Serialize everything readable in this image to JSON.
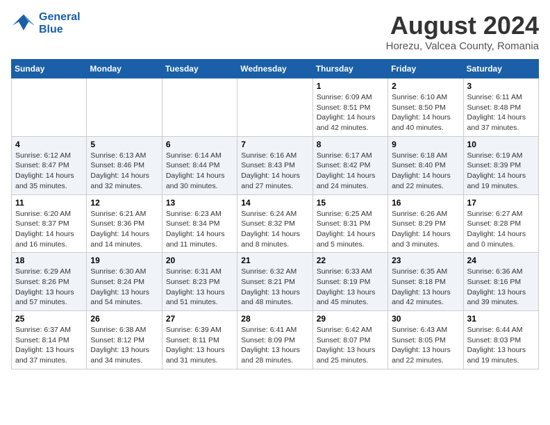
{
  "logo": {
    "line1": "General",
    "line2": "Blue"
  },
  "title": {
    "month_year": "August 2024",
    "location": "Horezu, Valcea County, Romania"
  },
  "days_of_week": [
    "Sunday",
    "Monday",
    "Tuesday",
    "Wednesday",
    "Thursday",
    "Friday",
    "Saturday"
  ],
  "weeks": [
    [
      {
        "num": "",
        "info": ""
      },
      {
        "num": "",
        "info": ""
      },
      {
        "num": "",
        "info": ""
      },
      {
        "num": "",
        "info": ""
      },
      {
        "num": "1",
        "info": "Sunrise: 6:09 AM\nSunset: 8:51 PM\nDaylight: 14 hours\nand 42 minutes."
      },
      {
        "num": "2",
        "info": "Sunrise: 6:10 AM\nSunset: 8:50 PM\nDaylight: 14 hours\nand 40 minutes."
      },
      {
        "num": "3",
        "info": "Sunrise: 6:11 AM\nSunset: 8:48 PM\nDaylight: 14 hours\nand 37 minutes."
      }
    ],
    [
      {
        "num": "4",
        "info": "Sunrise: 6:12 AM\nSunset: 8:47 PM\nDaylight: 14 hours\nand 35 minutes."
      },
      {
        "num": "5",
        "info": "Sunrise: 6:13 AM\nSunset: 8:46 PM\nDaylight: 14 hours\nand 32 minutes."
      },
      {
        "num": "6",
        "info": "Sunrise: 6:14 AM\nSunset: 8:44 PM\nDaylight: 14 hours\nand 30 minutes."
      },
      {
        "num": "7",
        "info": "Sunrise: 6:16 AM\nSunset: 8:43 PM\nDaylight: 14 hours\nand 27 minutes."
      },
      {
        "num": "8",
        "info": "Sunrise: 6:17 AM\nSunset: 8:42 PM\nDaylight: 14 hours\nand 24 minutes."
      },
      {
        "num": "9",
        "info": "Sunrise: 6:18 AM\nSunset: 8:40 PM\nDaylight: 14 hours\nand 22 minutes."
      },
      {
        "num": "10",
        "info": "Sunrise: 6:19 AM\nSunset: 8:39 PM\nDaylight: 14 hours\nand 19 minutes."
      }
    ],
    [
      {
        "num": "11",
        "info": "Sunrise: 6:20 AM\nSunset: 8:37 PM\nDaylight: 14 hours\nand 16 minutes."
      },
      {
        "num": "12",
        "info": "Sunrise: 6:21 AM\nSunset: 8:36 PM\nDaylight: 14 hours\nand 14 minutes."
      },
      {
        "num": "13",
        "info": "Sunrise: 6:23 AM\nSunset: 8:34 PM\nDaylight: 14 hours\nand 11 minutes."
      },
      {
        "num": "14",
        "info": "Sunrise: 6:24 AM\nSunset: 8:32 PM\nDaylight: 14 hours\nand 8 minutes."
      },
      {
        "num": "15",
        "info": "Sunrise: 6:25 AM\nSunset: 8:31 PM\nDaylight: 14 hours\nand 5 minutes."
      },
      {
        "num": "16",
        "info": "Sunrise: 6:26 AM\nSunset: 8:29 PM\nDaylight: 14 hours\nand 3 minutes."
      },
      {
        "num": "17",
        "info": "Sunrise: 6:27 AM\nSunset: 8:28 PM\nDaylight: 14 hours\nand 0 minutes."
      }
    ],
    [
      {
        "num": "18",
        "info": "Sunrise: 6:29 AM\nSunset: 8:26 PM\nDaylight: 13 hours\nand 57 minutes."
      },
      {
        "num": "19",
        "info": "Sunrise: 6:30 AM\nSunset: 8:24 PM\nDaylight: 13 hours\nand 54 minutes."
      },
      {
        "num": "20",
        "info": "Sunrise: 6:31 AM\nSunset: 8:23 PM\nDaylight: 13 hours\nand 51 minutes."
      },
      {
        "num": "21",
        "info": "Sunrise: 6:32 AM\nSunset: 8:21 PM\nDaylight: 13 hours\nand 48 minutes."
      },
      {
        "num": "22",
        "info": "Sunrise: 6:33 AM\nSunset: 8:19 PM\nDaylight: 13 hours\nand 45 minutes."
      },
      {
        "num": "23",
        "info": "Sunrise: 6:35 AM\nSunset: 8:18 PM\nDaylight: 13 hours\nand 42 minutes."
      },
      {
        "num": "24",
        "info": "Sunrise: 6:36 AM\nSunset: 8:16 PM\nDaylight: 13 hours\nand 39 minutes."
      }
    ],
    [
      {
        "num": "25",
        "info": "Sunrise: 6:37 AM\nSunset: 8:14 PM\nDaylight: 13 hours\nand 37 minutes."
      },
      {
        "num": "26",
        "info": "Sunrise: 6:38 AM\nSunset: 8:12 PM\nDaylight: 13 hours\nand 34 minutes."
      },
      {
        "num": "27",
        "info": "Sunrise: 6:39 AM\nSunset: 8:11 PM\nDaylight: 13 hours\nand 31 minutes."
      },
      {
        "num": "28",
        "info": "Sunrise: 6:41 AM\nSunset: 8:09 PM\nDaylight: 13 hours\nand 28 minutes."
      },
      {
        "num": "29",
        "info": "Sunrise: 6:42 AM\nSunset: 8:07 PM\nDaylight: 13 hours\nand 25 minutes."
      },
      {
        "num": "30",
        "info": "Sunrise: 6:43 AM\nSunset: 8:05 PM\nDaylight: 13 hours\nand 22 minutes."
      },
      {
        "num": "31",
        "info": "Sunrise: 6:44 AM\nSunset: 8:03 PM\nDaylight: 13 hours\nand 19 minutes."
      }
    ]
  ]
}
